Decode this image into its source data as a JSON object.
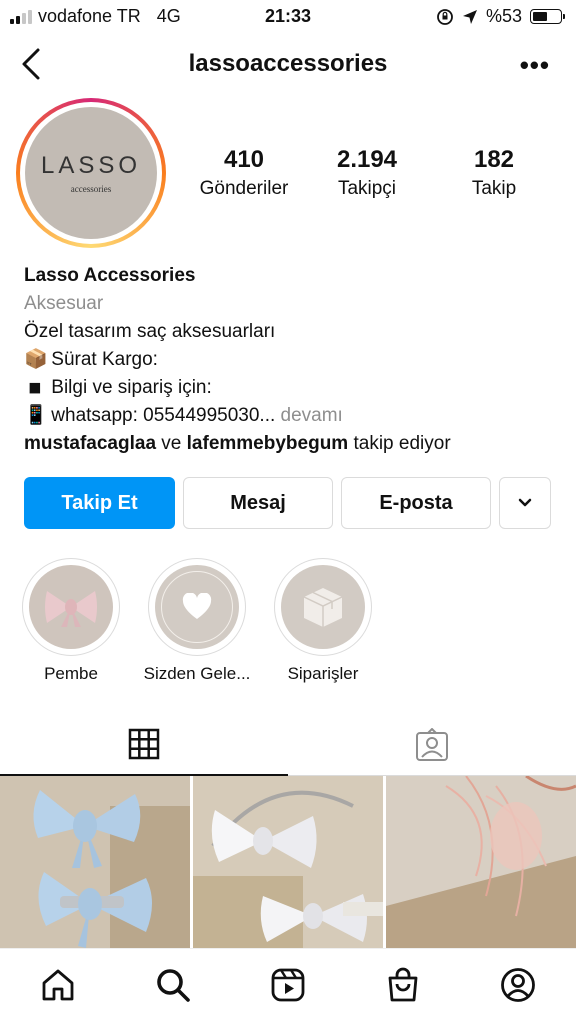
{
  "status_bar": {
    "carrier": "vodafone TR",
    "network": "4G",
    "time": "21:33",
    "battery": "%53",
    "battery_level": 0.53
  },
  "header": {
    "title": "lassoaccessories",
    "more_label": "•••"
  },
  "avatar": {
    "brand": "LASSO",
    "brand_sub": "accessories"
  },
  "stats": [
    {
      "num": "410",
      "label": "Gönderiler"
    },
    {
      "num": "2.194",
      "label": "Takipçi"
    },
    {
      "num": "182",
      "label": "Takip"
    }
  ],
  "bio": {
    "name": "Lasso Accessories",
    "category": "Aksesuar",
    "line1": "Özel tasarım saç aksesuarları",
    "line2_emoji": "📦",
    "line2": "Sürat Kargo:",
    "line3_emoji": "◾",
    "line3": "Bilgi ve sipariş için:",
    "line4_emoji": "📱",
    "line4": "whatsapp: 05544995030...",
    "more": "devamı",
    "followed_user1": "mustafacaglaa",
    "followed_conj": "ve",
    "followed_user2": "lafemmebybegum",
    "followed_suffix": "takip ediyor"
  },
  "buttons": {
    "follow": "Takip Et",
    "message": "Mesaj",
    "email": "E-posta"
  },
  "highlights": [
    {
      "label": "Pembe"
    },
    {
      "label": "Sizden Gele..."
    },
    {
      "label": "Siparişler"
    }
  ],
  "colors": {
    "accent": "#0095f6",
    "muted": "#8e8e8e",
    "border": "#dbdbdb"
  }
}
